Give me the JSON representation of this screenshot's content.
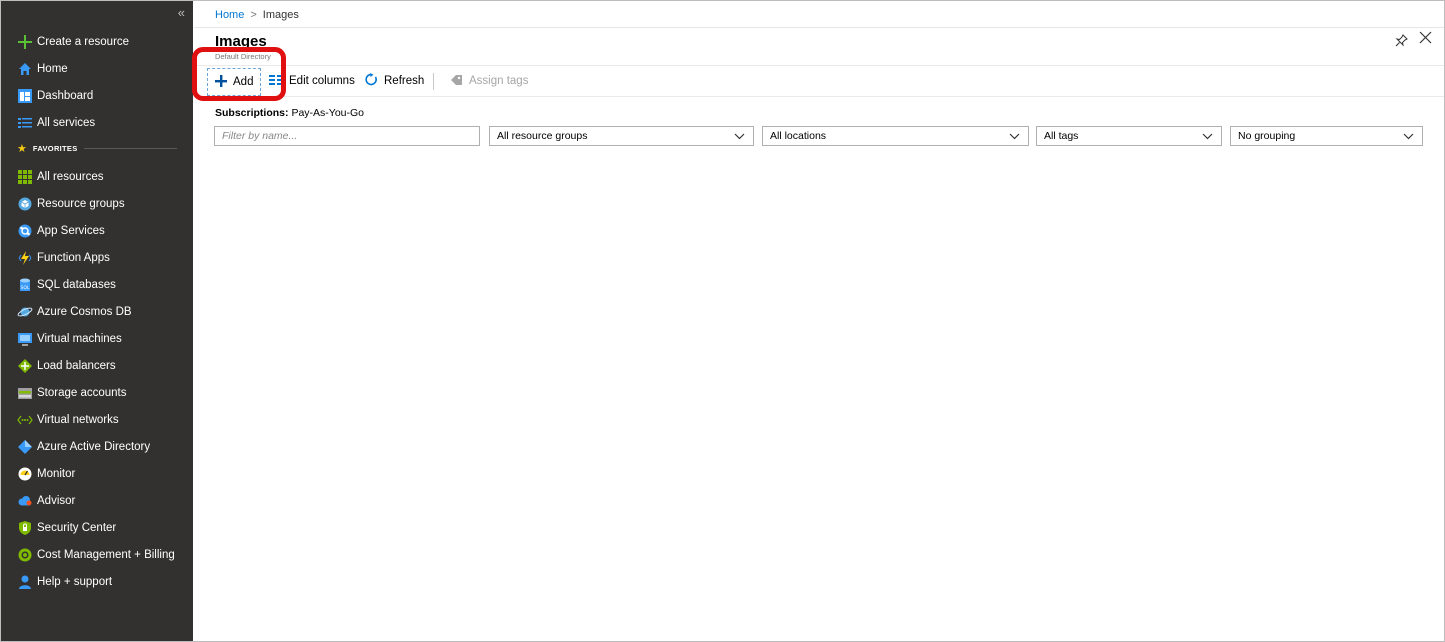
{
  "sidebar": {
    "collapse_label": "«",
    "items": [
      {
        "label": "Create a resource",
        "icon": "plus-icon",
        "color": "#5bc236"
      },
      {
        "label": "Home",
        "icon": "home-icon",
        "color": "#3999f7"
      },
      {
        "label": "Dashboard",
        "icon": "dashboard-icon",
        "color": "#3999f7"
      },
      {
        "label": "All services",
        "icon": "list-icon",
        "color": "#3999f7"
      },
      {
        "label": "All resources",
        "icon": "grid-icon",
        "color": "#7fba00"
      },
      {
        "label": "Resource groups",
        "icon": "cube-icon",
        "color": "#55a8e0"
      },
      {
        "label": "App Services",
        "icon": "app-services-icon",
        "color": "#3999f7"
      },
      {
        "label": "Function Apps",
        "icon": "bolt-icon",
        "color": "#fcd116"
      },
      {
        "label": "SQL databases",
        "icon": "database-icon",
        "color": "#3999f7"
      },
      {
        "label": "Azure Cosmos DB",
        "icon": "planet-icon",
        "color": "#55a8e0"
      },
      {
        "label": "Virtual machines",
        "icon": "monitor-icon",
        "color": "#3999f7"
      },
      {
        "label": "Load balancers",
        "icon": "diamond-icon",
        "color": "#7fba00"
      },
      {
        "label": "Storage accounts",
        "icon": "storage-icon",
        "color": "#a0a0a0"
      },
      {
        "label": "Virtual networks",
        "icon": "network-icon",
        "color": "#7fba00"
      },
      {
        "label": "Azure Active Directory",
        "icon": "aad-icon",
        "color": "#3999f7"
      },
      {
        "label": "Monitor",
        "icon": "gauge-icon",
        "color": "#ffffff"
      },
      {
        "label": "Advisor",
        "icon": "cloud-icon",
        "color": "#3999f7"
      },
      {
        "label": "Security Center",
        "icon": "shield-icon",
        "color": "#7fba00"
      },
      {
        "label": "Cost Management + Billing",
        "icon": "cost-icon",
        "color": "#7fba00"
      },
      {
        "label": "Help + support",
        "icon": "person-icon",
        "color": "#3999f7"
      }
    ],
    "favorites_label": "FAVORITES"
  },
  "breadcrumb": {
    "home": "Home",
    "separator": ">",
    "current": "Images"
  },
  "page": {
    "title": "Images",
    "subtitle": "Default Directory"
  },
  "toolbar": {
    "add_label": "Add",
    "edit_columns_label": "Edit columns",
    "refresh_label": "Refresh",
    "assign_tags_label": "Assign tags"
  },
  "subscriptions": {
    "label": "Subscriptions:",
    "value": "Pay-As-You-Go"
  },
  "filters": {
    "name_placeholder": "Filter by name...",
    "resource_groups": "All resource groups",
    "locations": "All locations",
    "tags": "All tags",
    "grouping": "No grouping"
  },
  "colors": {
    "sidebar_bg": "#323130",
    "accent": "#0078d4",
    "highlight": "#e01010"
  }
}
